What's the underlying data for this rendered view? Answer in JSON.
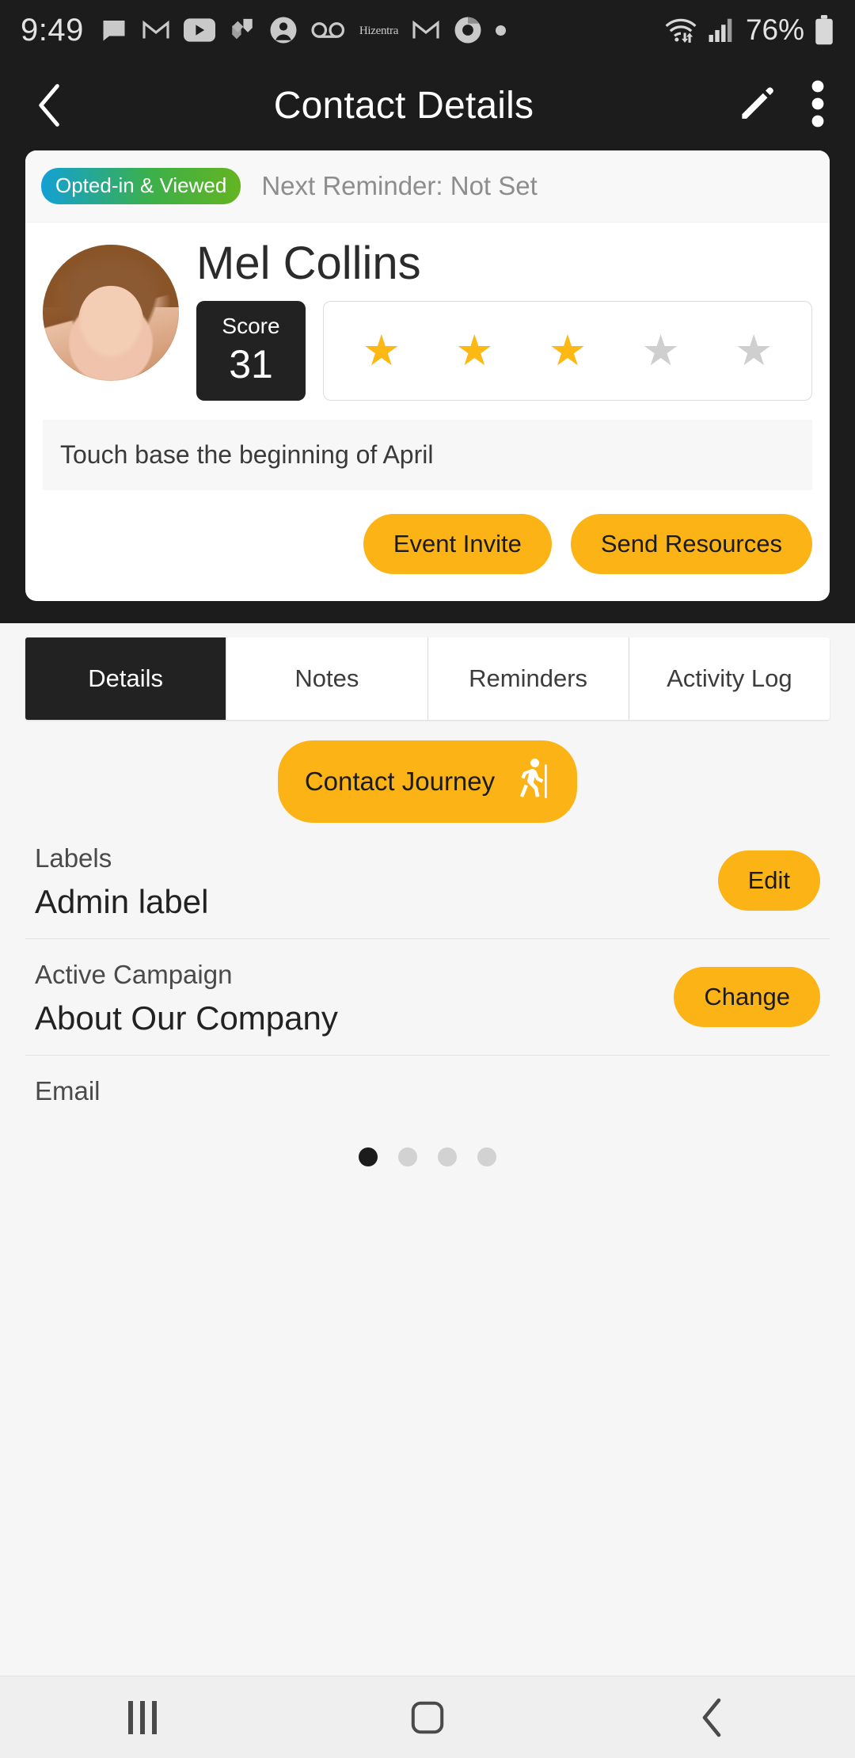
{
  "status_bar": {
    "time": "9:49",
    "battery_percent": "76%",
    "hizentra_label": "Hizentra",
    "icons": [
      "message-icon",
      "gmail-icon",
      "youtube-icon",
      "jira-icon",
      "account-icon",
      "voicemail-icon",
      "hizentra-icon",
      "gmail-icon-2",
      "chrome-icon",
      "dot-indicator",
      "wifi-icon",
      "cellular-signal-icon",
      "battery-icon"
    ]
  },
  "app_bar": {
    "title": "Contact Details",
    "back_icon": "back-chevron-icon",
    "edit_icon": "pencil-edit-icon",
    "overflow_icon": "more-vertical-icon"
  },
  "contact_card": {
    "status_badge": "Opted-in & Viewed",
    "next_reminder": "Next Reminder: Not Set",
    "name": "Mel Collins",
    "score_label": "Score",
    "score_value": "31",
    "rating": 3,
    "rating_max": 5,
    "note": "Touch base the beginning of April",
    "actions": [
      {
        "label": "Event Invite",
        "name": "event-invite-button"
      },
      {
        "label": "Send Resources",
        "name": "send-resources-button"
      }
    ]
  },
  "tabs": [
    {
      "label": "Details",
      "active": true
    },
    {
      "label": "Notes",
      "active": false
    },
    {
      "label": "Reminders",
      "active": false
    },
    {
      "label": "Activity Log",
      "active": false
    }
  ],
  "journey_button": {
    "label": "Contact Journey",
    "icon": "hiking-person-icon"
  },
  "fields": [
    {
      "label": "Labels",
      "value": "Admin label",
      "action": "Edit"
    },
    {
      "label": "Active Campaign",
      "value": "About Our Company",
      "action": "Change"
    },
    {
      "label": "Email",
      "value": "",
      "action": ""
    }
  ],
  "pagination": {
    "total": 4,
    "active_index": 0
  },
  "nav_bar": {
    "recents_icon": "recents-icon",
    "home_icon": "home-icon",
    "back_icon": "nav-back-icon"
  },
  "colors": {
    "accent_yellow": "#fbb316",
    "dark": "#1c1c1c",
    "badge_blue": "#13a0d5",
    "badge_green": "#64b420",
    "star_gold": "#fdb813",
    "star_grey": "#cfcfcf"
  }
}
